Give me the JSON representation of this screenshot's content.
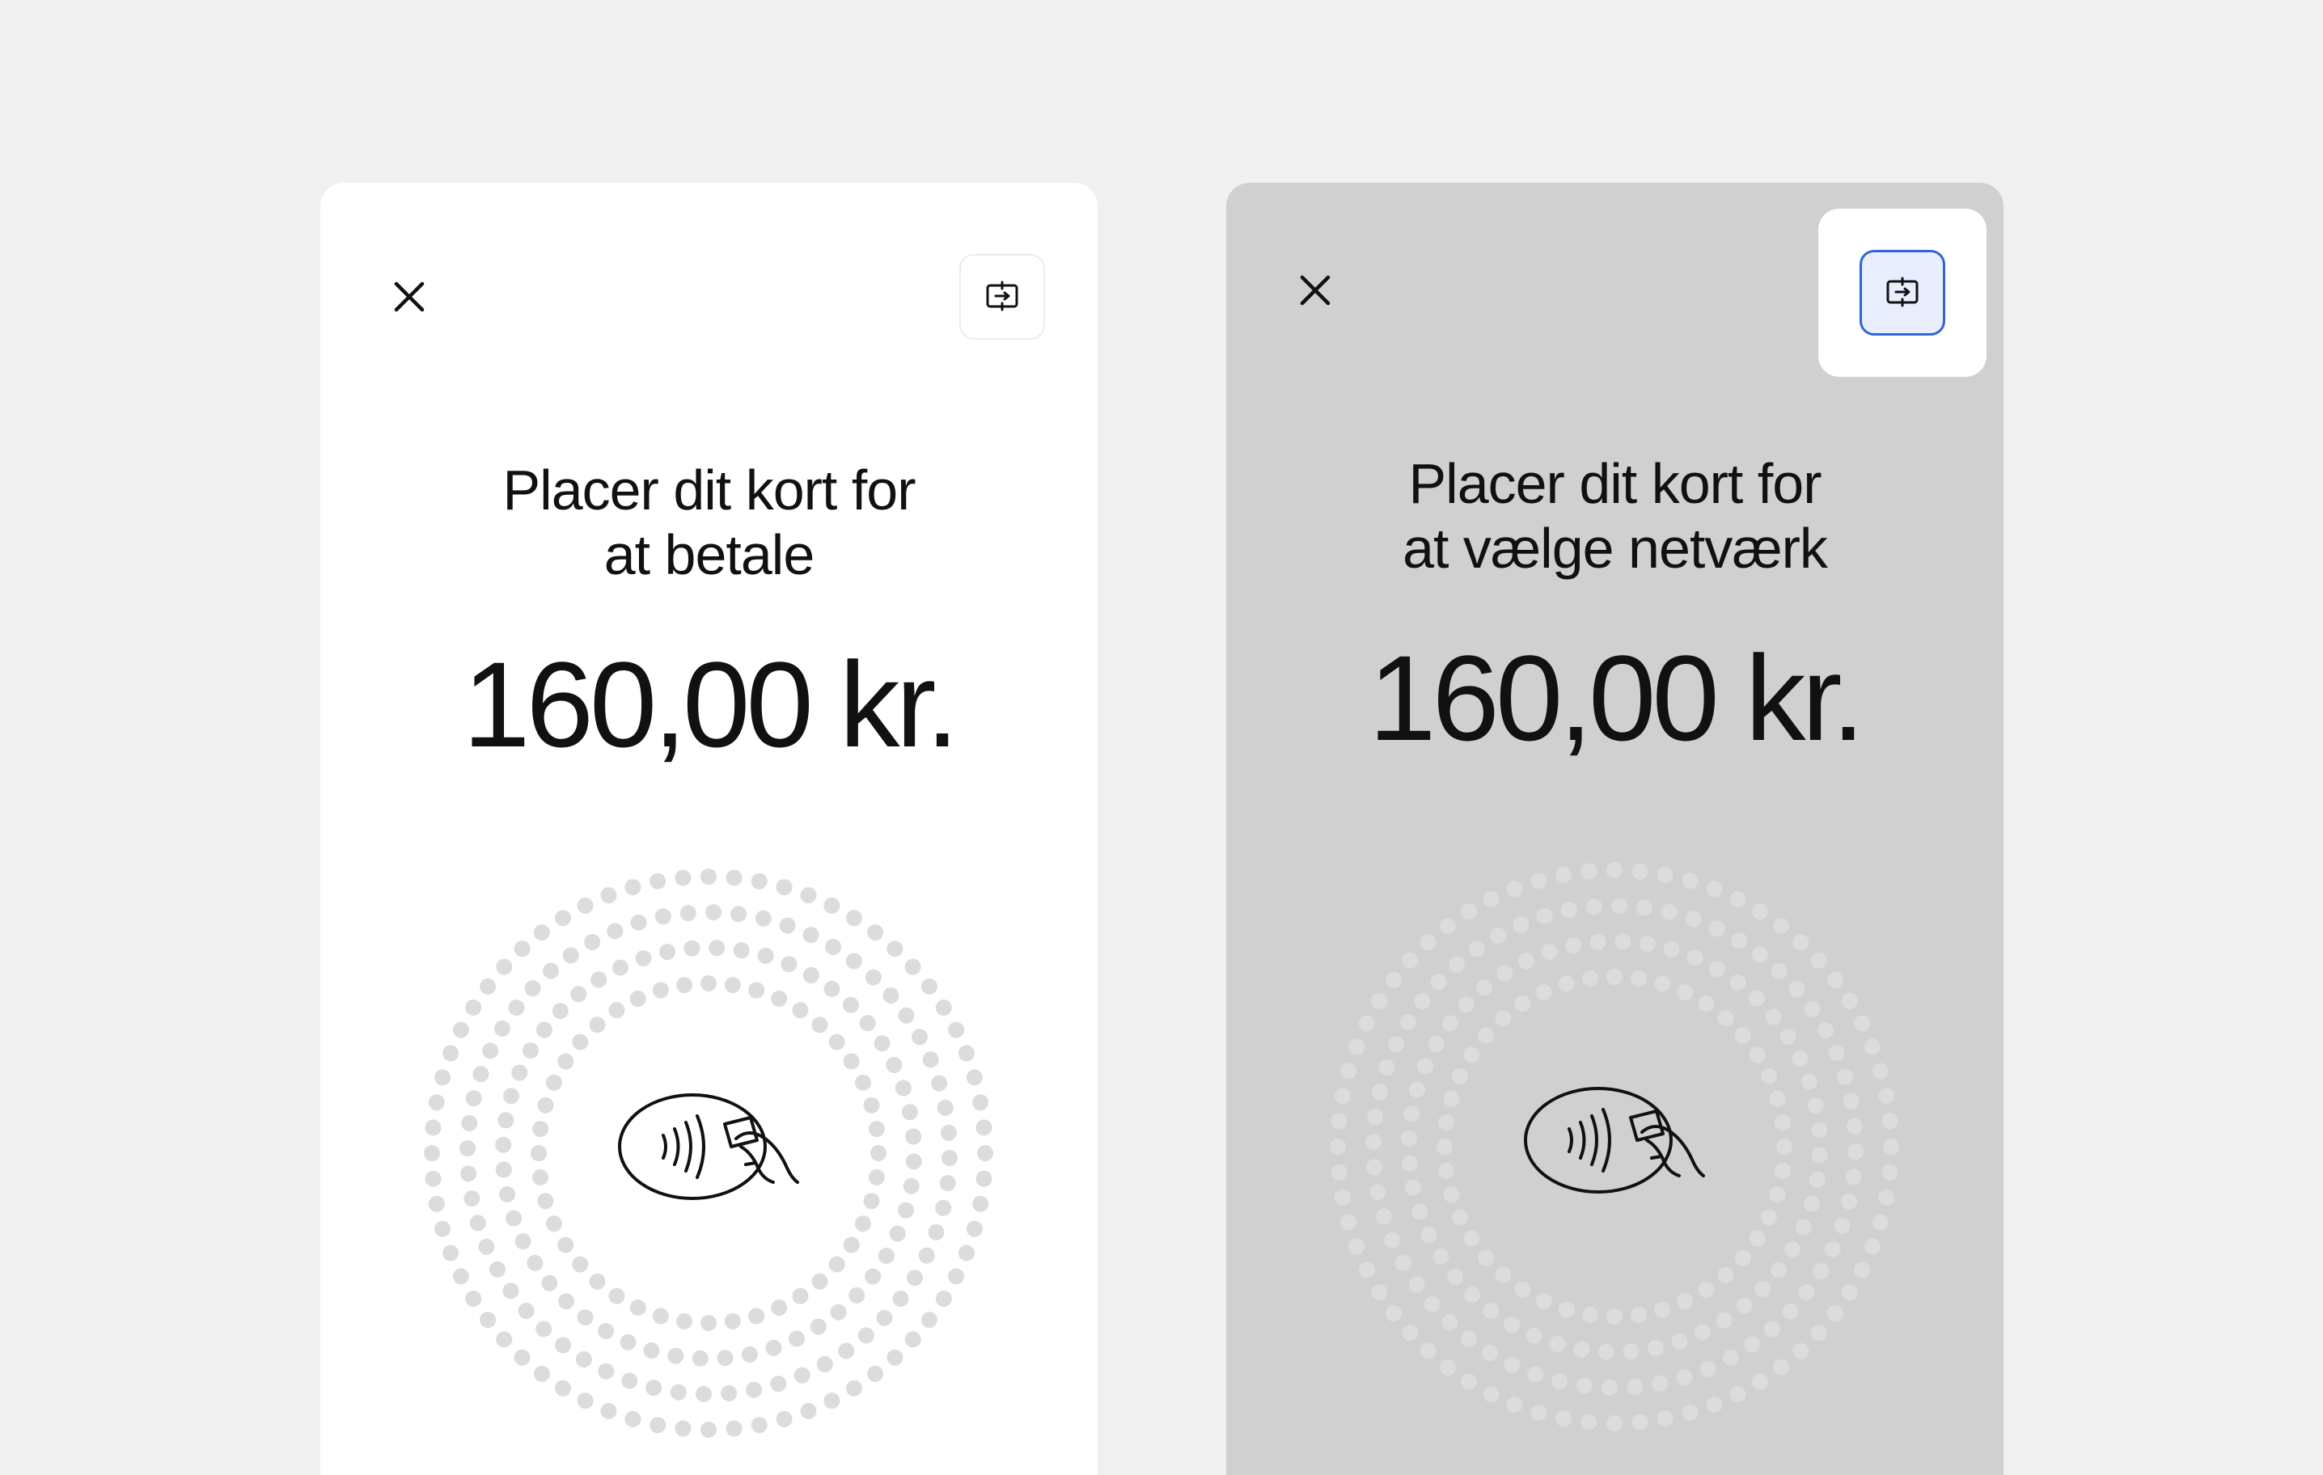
{
  "colors": {
    "page_background": "#f0f0f0",
    "screen_default": "#ffffff",
    "screen_dimmed": "#d0d0d0",
    "text": "#111111",
    "dot": "#dcdcdc",
    "selected_border": "#3164d8",
    "selected_fill": "#e9eeff"
  },
  "screens": [
    {
      "state": "default",
      "close_icon": "close-icon",
      "network_icon": "network-switch-icon",
      "network_selected": false,
      "instruction_line1": "Placer dit kort for",
      "instruction_line2": "at betale",
      "amount": "160,00 kr.",
      "reader_icon": "contactless-tap-card-icon"
    },
    {
      "state": "network-button-highlighted",
      "close_icon": "close-icon",
      "network_icon": "network-switch-icon",
      "network_selected": true,
      "instruction_line1": "Placer dit kort for",
      "instruction_line2": "at vælge netværk",
      "amount": "160,00 kr.",
      "reader_icon": "contactless-tap-card-icon"
    }
  ]
}
